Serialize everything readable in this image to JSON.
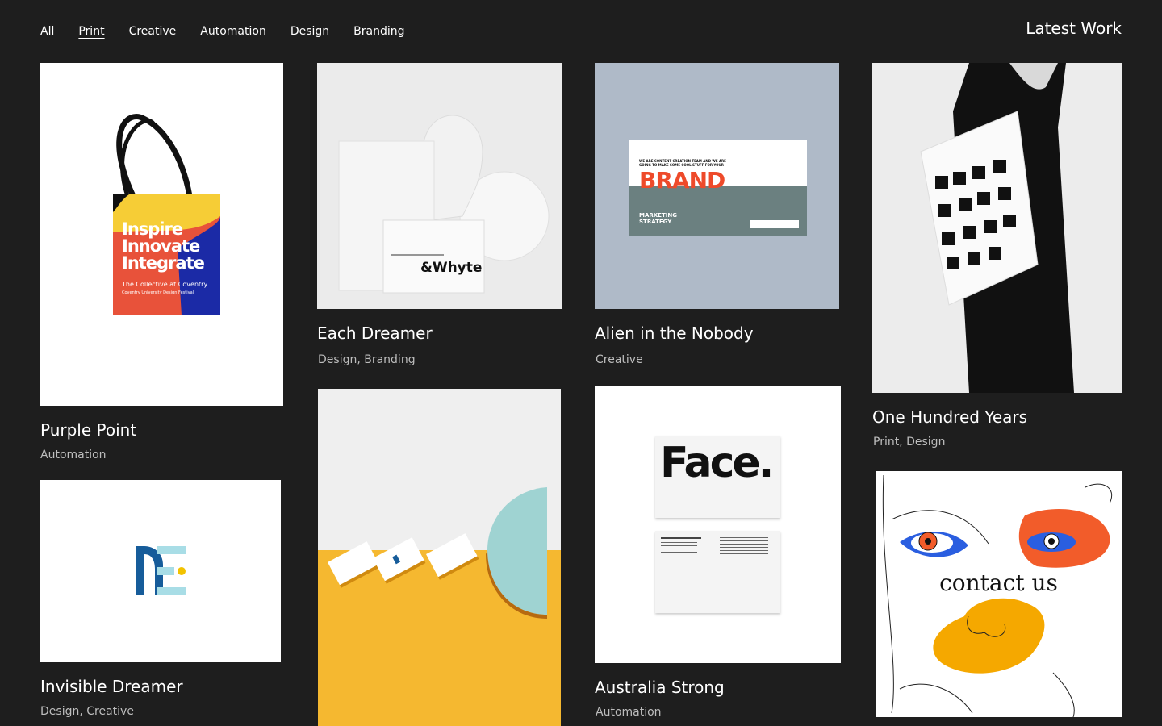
{
  "nav": {
    "items": [
      "All",
      "Print",
      "Creative",
      "Automation",
      "Design",
      "Branding"
    ],
    "active": "Print"
  },
  "header": {
    "title": "Latest Work"
  },
  "cards": [
    {
      "title": "Purple Point",
      "tags": "Automation",
      "art": {
        "lines": [
          "Inspire",
          "Innovate",
          "Integrate"
        ],
        "sub1": "The Collective at Coventry",
        "sub2": "Coventry University Design Festival"
      }
    },
    {
      "title": "Each Dreamer",
      "tags": "Design, Branding",
      "art": {
        "brand": "&Whyte"
      }
    },
    {
      "title": "Alien in the Nobody",
      "tags": "Creative",
      "art": {
        "headline": "WE ARE CONTENT CREATION TEAM AND WE ARE GOING TO MAKE SOME COOL STUFF FOR YOUR",
        "big": "BRAND",
        "sub": "MARKETING STRATEGY"
      }
    },
    {
      "title": "One Hundred Years",
      "tags": "Print, Design"
    },
    {
      "title": "Invisible Dreamer",
      "tags": "Design, Creative"
    },
    {
      "title": "",
      "tags": ""
    },
    {
      "title": "Australia Strong",
      "tags": "Automation",
      "art": {
        "word": "Face."
      }
    },
    {
      "title": "",
      "tags": "",
      "art": {
        "text": "contact us"
      }
    }
  ]
}
